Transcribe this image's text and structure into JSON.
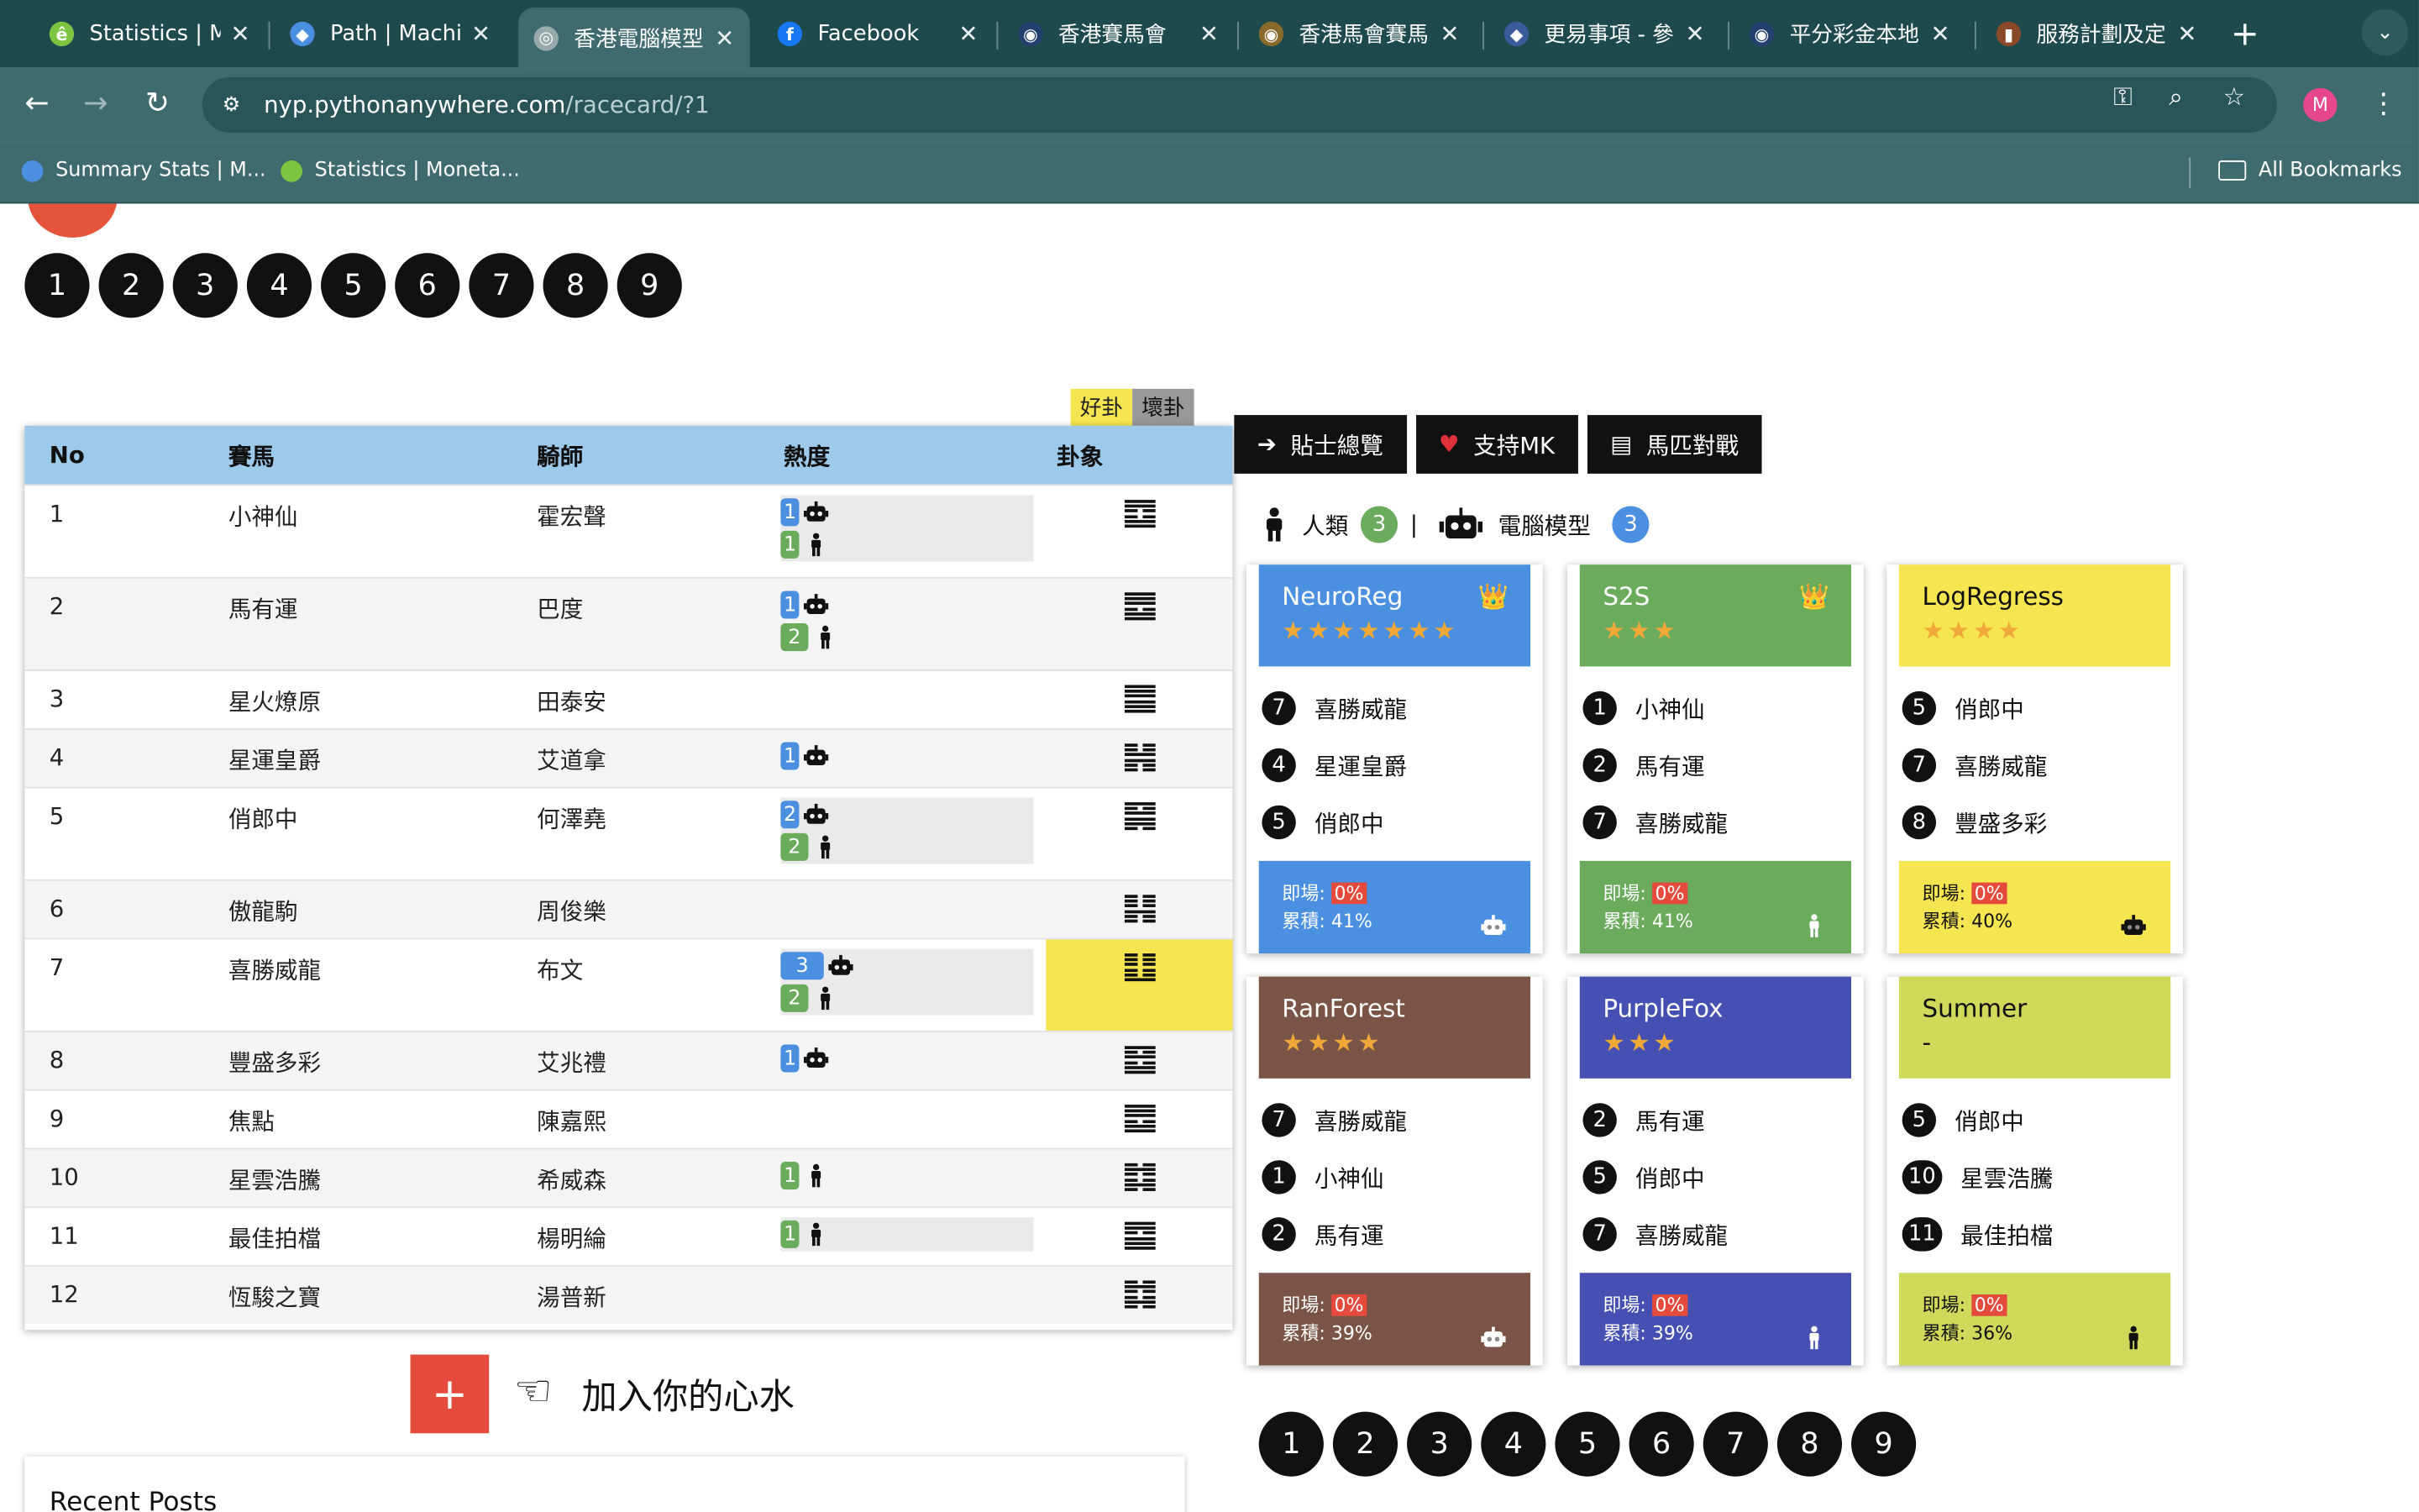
{
  "browser": {
    "tabs": [
      {
        "title": "Statistics | M",
        "fav_color": "#7cc540",
        "fav_glyph": "ê"
      },
      {
        "title": "Path | Machin",
        "fav_color": "#4a8fe0",
        "fav_glyph": "◆"
      },
      {
        "title": "香港電腦模型",
        "fav_color": "#9aa",
        "fav_glyph": "◎",
        "active": true
      },
      {
        "title": "Facebook",
        "fav_color": "#1877f2",
        "fav_glyph": "f"
      },
      {
        "title": "香港賽馬會",
        "fav_color": "#24406e",
        "fav_glyph": "◉"
      },
      {
        "title": "香港馬會賽馬",
        "fav_color": "#8a6a2a",
        "fav_glyph": "◉"
      },
      {
        "title": "更易事項 - 參",
        "fav_color": "#3a5a9a",
        "fav_glyph": "◆"
      },
      {
        "title": "平分彩金本地",
        "fav_color": "#24406e",
        "fav_glyph": "◉"
      },
      {
        "title": "服務計劃及定",
        "fav_color": "#8a4a2a",
        "fav_glyph": "▮"
      }
    ],
    "url_host": "nyp.pythonanywhere.com",
    "url_path": "/racecard/?1",
    "avatar_letter": "M",
    "bookmarks": [
      {
        "label": "Summary Stats | M...",
        "fav_color": "#4a8fe0"
      },
      {
        "label": "Statistics | Moneta...",
        "fav_color": "#7cc540"
      }
    ],
    "all_bookmarks": "All Bookmarks"
  },
  "pager": [
    "1",
    "2",
    "3",
    "4",
    "5",
    "6",
    "7",
    "8",
    "9"
  ],
  "gua_legend": {
    "good": "好卦",
    "bad": "壞卦"
  },
  "table": {
    "headers": {
      "no": "No",
      "horse": "賽馬",
      "jockey": "騎師",
      "heat": "熱度",
      "gua": "卦象"
    },
    "rows": [
      {
        "no": "1",
        "horse": "小神仙",
        "jockey": "霍宏聲",
        "robot": "1",
        "human": "1",
        "gua": [
          1,
          1,
          0,
          0,
          1,
          1
        ],
        "alt": false
      },
      {
        "no": "2",
        "horse": "馬有運",
        "jockey": "巴度",
        "robot": "1",
        "human": "2",
        "gua": [
          1,
          1,
          1,
          0,
          1,
          1
        ],
        "alt": true
      },
      {
        "no": "3",
        "horse": "星火燎原",
        "jockey": "田泰安",
        "robot": "",
        "human": "",
        "gua": [
          1,
          1,
          1,
          1,
          1,
          1
        ],
        "alt": false
      },
      {
        "no": "4",
        "horse": "星運皇爵",
        "jockey": "艾道拿",
        "robot": "1",
        "human": "",
        "gua": [
          0,
          0,
          1,
          1,
          0,
          0
        ],
        "alt": true
      },
      {
        "no": "5",
        "horse": "俏郎中",
        "jockey": "何澤堯",
        "robot": "2",
        "human": "2",
        "gua": [
          1,
          0,
          1,
          1,
          1,
          0
        ],
        "alt": false
      },
      {
        "no": "6",
        "horse": "傲龍駒",
        "jockey": "周俊樂",
        "robot": "",
        "human": "",
        "gua": [
          0,
          0,
          0,
          1,
          0,
          0
        ],
        "alt": true
      },
      {
        "no": "7",
        "horse": "喜勝威龍",
        "jockey": "布文",
        "robot": "3",
        "human": "2",
        "gua": [
          0,
          0,
          0,
          0,
          0,
          1
        ],
        "alt": false,
        "highlight": true
      },
      {
        "no": "8",
        "horse": "豐盛多彩",
        "jockey": "艾兆禮",
        "robot": "1",
        "human": "",
        "gua": [
          1,
          0,
          1,
          0,
          1,
          1
        ],
        "alt": true
      },
      {
        "no": "9",
        "horse": "焦點",
        "jockey": "陳嘉熙",
        "robot": "",
        "human": "",
        "gua": [
          1,
          1,
          1,
          0,
          1,
          1
        ],
        "alt": false
      },
      {
        "no": "10",
        "horse": "星雲浩騰",
        "jockey": "希威森",
        "robot": "",
        "human": "1",
        "gua": [
          0,
          1,
          0,
          0,
          1,
          0
        ],
        "alt": true
      },
      {
        "no": "11",
        "horse": "最佳拍檔",
        "jockey": "楊明綸",
        "robot": "",
        "human": "1",
        "gua": [
          1,
          1,
          0,
          1,
          1,
          1
        ],
        "alt": false
      },
      {
        "no": "12",
        "horse": "恆駿之寶",
        "jockey": "湯普新",
        "robot": "",
        "human": "",
        "gua": [
          0,
          1,
          0,
          0,
          1,
          0
        ],
        "alt": true
      }
    ]
  },
  "add_heart": "加入你的心水",
  "recent_posts": "Recent Posts",
  "buttons": {
    "tips": "貼士總覽",
    "support": "支持MK",
    "duel": "馬匹對戰"
  },
  "counts": {
    "human_label": "人類",
    "human_count": "3",
    "sep": "|",
    "model_label": "電腦模型",
    "model_count": "3"
  },
  "models": [
    {
      "name": "NeuroReg",
      "stars": "★★★★★★★",
      "color": "#4a8fe0",
      "crown": "👑",
      "picks": [
        [
          "7",
          "喜勝威龍"
        ],
        [
          "4",
          "星運皇爵"
        ],
        [
          "5",
          "俏郎中"
        ]
      ],
      "today_label": "即場:",
      "today": "0%",
      "cum_label": "累積:",
      "cum": "41%",
      "type": "robot"
    },
    {
      "name": "S2S",
      "stars": "★★★",
      "color": "#6aab5c",
      "crown": "👑",
      "picks": [
        [
          "1",
          "小神仙"
        ],
        [
          "2",
          "馬有運"
        ],
        [
          "7",
          "喜勝威龍"
        ]
      ],
      "today_label": "即場:",
      "today": "0%",
      "cum_label": "累積:",
      "cum": "41%",
      "type": "human"
    },
    {
      "name": "LogRegress",
      "stars": "★★★★",
      "color": "#f5e651",
      "crown": "",
      "picks": [
        [
          "5",
          "俏郎中"
        ],
        [
          "7",
          "喜勝威龍"
        ],
        [
          "8",
          "豐盛多彩"
        ]
      ],
      "today_label": "即場:",
      "today": "0%",
      "cum_label": "累積:",
      "cum": "40%",
      "type": "robot"
    },
    {
      "name": "RanForest",
      "stars": "★★★★",
      "color": "#7a5446",
      "crown": "",
      "picks": [
        [
          "7",
          "喜勝威龍"
        ],
        [
          "1",
          "小神仙"
        ],
        [
          "2",
          "馬有運"
        ]
      ],
      "today_label": "即場:",
      "today": "0%",
      "cum_label": "累積:",
      "cum": "39%",
      "type": "robot"
    },
    {
      "name": "PurpleFox",
      "stars": "★★★",
      "color": "#4650b2",
      "crown": "",
      "picks": [
        [
          "2",
          "馬有運"
        ],
        [
          "5",
          "俏郎中"
        ],
        [
          "7",
          "喜勝威龍"
        ]
      ],
      "today_label": "即場:",
      "today": "0%",
      "cum_label": "累積:",
      "cum": "39%",
      "type": "human"
    },
    {
      "name": "Summer",
      "stars": "-",
      "color": "#cfd95a",
      "crown": "",
      "picks": [
        [
          "5",
          "俏郎中"
        ],
        [
          "10",
          "星雲浩騰"
        ],
        [
          "11",
          "最佳拍檔"
        ]
      ],
      "today_label": "即場:",
      "today": "0%",
      "cum_label": "累積:",
      "cum": "36%",
      "type": "human"
    }
  ]
}
